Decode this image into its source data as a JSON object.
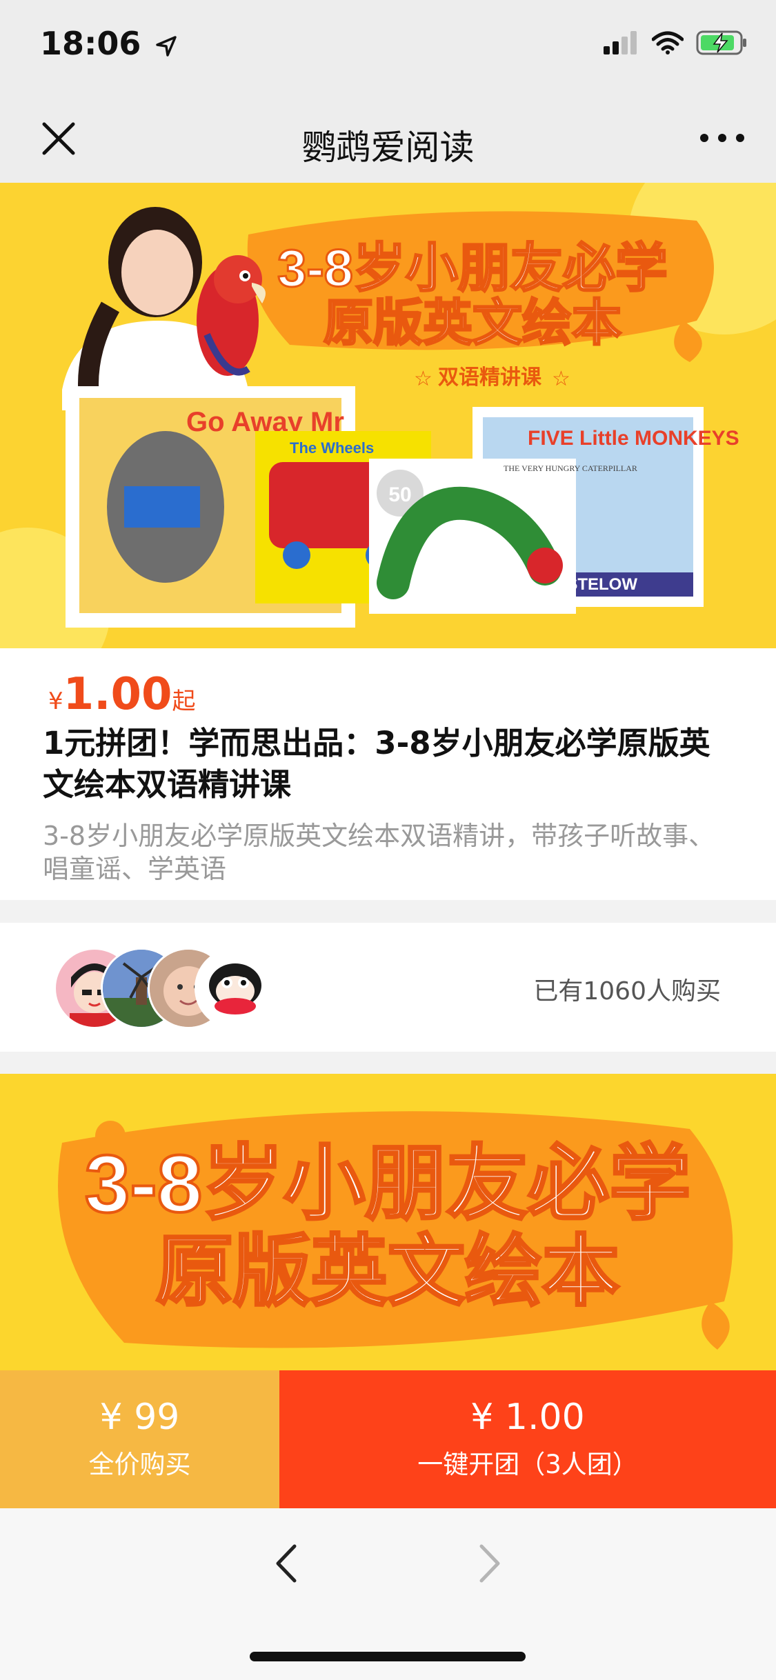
{
  "status_bar": {
    "time": "18:06"
  },
  "nav": {
    "title": "鹦鹉爱阅读"
  },
  "banner": {
    "headline_line1": "3-8岁小朋友必学",
    "headline_line2": "原版英文绘本",
    "tag": "双语精讲课",
    "books": [
      {
        "title": "Go Away Mr"
      },
      {
        "title": "The Wheels"
      },
      {
        "title": "THE VERY HUNGRY CATERPILLAR",
        "badge": "50"
      },
      {
        "title": "FIVE Little MONKEYS",
        "author": "HRISTELOW"
      }
    ],
    "colors": {
      "bg": "#fcd331",
      "blob": "#fb9a1d",
      "headline": "#ffffff"
    }
  },
  "product": {
    "price_currency": "¥",
    "price_value": "1.00",
    "price_suffix": "起",
    "title": "1元拼团！学而思出品：3-8岁小朋友必学原版英文绘本双语精讲课",
    "subtitle": "3-8岁小朋友必学原版英文绘本双语精讲，带孩子听故事、唱童谣、学英语"
  },
  "buyers": {
    "count_text": "已有1060人购买"
  },
  "detail_banner": {
    "line1": "3-8岁小朋友必学",
    "line2": "原版英文绘本"
  },
  "buy_bar": {
    "full_price": "¥ 99",
    "full_label": "全价购买",
    "group_price": "¥ 1.00",
    "group_label": "一键开团（3人团）",
    "colors": {
      "full": "#f6b843",
      "group": "#fe4219"
    }
  }
}
